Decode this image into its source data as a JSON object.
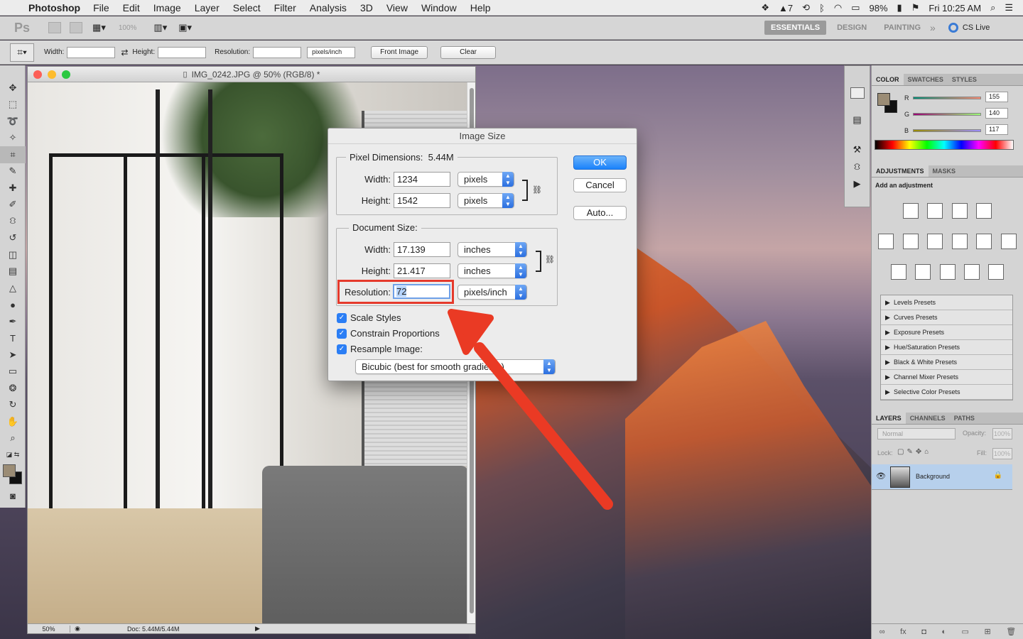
{
  "menubar": {
    "app_name": "Photoshop",
    "items": [
      "File",
      "Edit",
      "Image",
      "Layer",
      "Select",
      "Filter",
      "Analysis",
      "3D",
      "View",
      "Window",
      "Help"
    ],
    "status_right": {
      "notifications": "7",
      "battery": "98%",
      "clock": "Fri 10:25 AM"
    }
  },
  "appbar": {
    "logo": "Ps",
    "zoom": "100%",
    "workspaces": [
      "ESSENTIALS",
      "DESIGN",
      "PAINTING"
    ],
    "active_workspace": "ESSENTIALS",
    "more": "»",
    "cs_live": "CS Live"
  },
  "options_bar": {
    "width_label": "Width:",
    "height_label": "Height:",
    "resolution_label": "Resolution:",
    "resolution_unit": "pixels/inch",
    "front_image_label": "Front Image",
    "clear_label": "Clear"
  },
  "document": {
    "title": "IMG_0242.JPG @ 50% (RGB/8) *",
    "zoom": "50%",
    "doc_info": "Doc: 5.44M/5.44M"
  },
  "dialog": {
    "title": "Image Size",
    "pixel_dimensions_label": "Pixel Dimensions:",
    "pixel_dimensions_size": "5.44M",
    "px_width_label": "Width:",
    "px_width_value": "1234",
    "px_width_unit": "pixels",
    "px_height_label": "Height:",
    "px_height_value": "1542",
    "px_height_unit": "pixels",
    "document_size_label": "Document Size:",
    "doc_width_label": "Width:",
    "doc_width_value": "17.139",
    "doc_width_unit": "inches",
    "doc_height_label": "Height:",
    "doc_height_value": "21.417",
    "doc_height_unit": "inches",
    "resolution_label": "Resolution:",
    "resolution_value": "72",
    "resolution_unit": "pixels/inch",
    "scale_styles_label": "Scale Styles",
    "constrain_label": "Constrain Proportions",
    "resample_label": "Resample Image:",
    "resample_method": "Bicubic (best for smooth gradients)",
    "ok_label": "OK",
    "cancel_label": "Cancel",
    "auto_label": "Auto...",
    "scale_styles_checked": true,
    "constrain_checked": true,
    "resample_checked": true
  },
  "color_panel": {
    "tabs": [
      "COLOR",
      "SWATCHES",
      "STYLES"
    ],
    "r_label": "R",
    "r_value": "155",
    "g_label": "G",
    "g_value": "140",
    "b_label": "B",
    "b_value": "117",
    "r_level": 155,
    "g_level": 140,
    "b_level": 117,
    "foreground_color": "#9b8c75"
  },
  "adjustments_panel": {
    "tabs": [
      "ADJUSTMENTS",
      "MASKS"
    ],
    "hint": "Add an adjustment",
    "presets": [
      "Levels Presets",
      "Curves Presets",
      "Exposure Presets",
      "Hue/Saturation Presets",
      "Black & White Presets",
      "Channel Mixer Presets",
      "Selective Color Presets"
    ]
  },
  "layers_panel": {
    "tabs": [
      "LAYERS",
      "CHANNELS",
      "PATHS"
    ],
    "blend_mode": "Normal",
    "opacity_label": "Opacity:",
    "opacity_value": "100%",
    "lock_label": "Lock:",
    "fill_label": "Fill:",
    "fill_value": "100%",
    "layer_name": "Background"
  },
  "colors": {
    "highlight_red": "#e53a2c",
    "accent_blue": "#2b7ef5"
  }
}
